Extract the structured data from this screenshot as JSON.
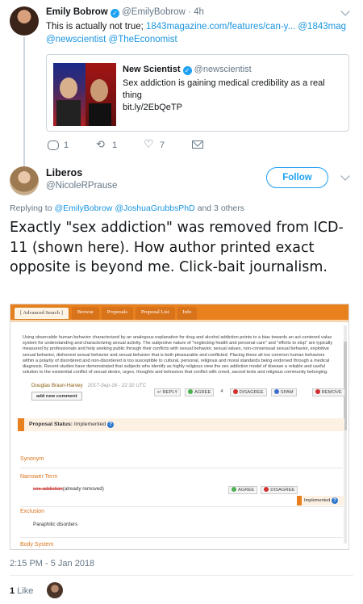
{
  "parent_tweet": {
    "name": "Emily Bobrow",
    "handle": "@EmilyBobrow",
    "separator": "·",
    "age": "4h",
    "text_plain": "This is actually not true; ",
    "link_url": "1843magazine.com/features/can-y...",
    "mention_1843": "@1843mag",
    "mention_newscientist": "@newscientist",
    "mention_economist": "@TheEconomist",
    "quote": {
      "name": "New Scientist",
      "handle": "@newscientist",
      "text": "Sex addiction is gaining medical credibility as a real thing",
      "link": "bit.ly/2EbQeTP"
    },
    "replies": "1",
    "retweets": "1",
    "likes": "7"
  },
  "main_tweet": {
    "name": "Liberos",
    "handle": "@NicoleRPrause",
    "follow_label": "Follow",
    "replying_prefix": "Replying to",
    "replying_1": "@EmilyBobrow",
    "replying_2": "@JoshuaGrubbsPhD",
    "replying_suffix": "and 3 others",
    "text": "Exactly \"sex addiction\" was removed from ICD-11 (shown here). How author printed exact opposite is beyond me. Click-bait journalism.",
    "timestamp": "2:15 PM - 5 Jan 2018",
    "like_count": "1",
    "like_label": "Like"
  },
  "screenshot": {
    "tabs": [
      "[ Advanced Search ]",
      "Browse",
      "Proposals",
      "Proposal List",
      "Info"
    ],
    "comment": "Using observable human behavior characterized by an analogous explanation for drug and alcohol addiction points to a bias towards an act-centered value system for understanding and characterizing sexual activity. The subjective nature of \"neglecting health and personal care\" and \"efforts to stop\" are typically measured by professionals and help seeking public through their conflicts with sexual behavior, sexual values, non-consensual sexual behavior, exploitive sexual behavior, dishonest sexual behavior and sexual behavior that is both pleasurable and conflicted. Placing these all too common human behaviors within a polarity of disordered and non-disordered is too susceptible to cultural, personal, religious and moral standards being endorsed through a medical diagnosis. Recent studies have demonstrated that subjects who identify as highly religious view the sex addiction model of disease a reliable and useful solution to the existential conflict of sexual desire, urges, thoughts and behaviors that conflict with creed, sacred texts and religious community belonging.",
    "author": "Douglas Braun-Harvey",
    "date": "2017-Sep-16 - 22:32 UTC",
    "reply_label": "REPLY",
    "agree_label": "AGREE",
    "agree_count": "4",
    "disagree_label": "DISAGREE",
    "spam_label": "SPAM",
    "remove_label": "REMOVE",
    "add_comment_label": "add new comment",
    "status_label": "Proposal Status:",
    "status_value": "Implemented",
    "synonym_label": "Synonym",
    "narrower_label": "Narrower Term",
    "narrower_strike": "sex addiction",
    "narrower_note": "(already removed)",
    "small_agree": "AGREE",
    "small_disagree": "DISAGREE",
    "implemented_tag": "Implemented",
    "exclusion_label": "Exclusion",
    "exclusion_value": "Paraphilic disorders",
    "body_system_label": "Body System"
  },
  "colors": {
    "link": "#1b95e0",
    "accent": "#1da1f2",
    "icd_orange": "#e8801e",
    "muted": "#657786"
  }
}
